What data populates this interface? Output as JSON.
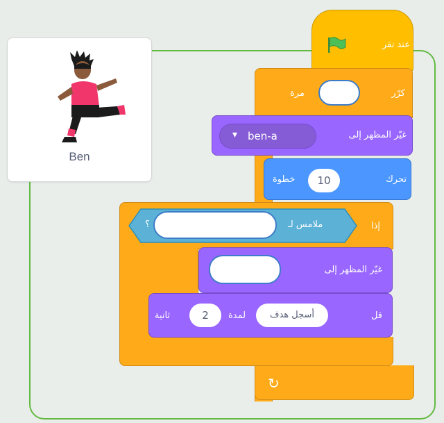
{
  "sprite": {
    "name": "Ben"
  },
  "blocks": {
    "hat": {
      "label": "عند نقر",
      "flag_icon": "green-flag-icon"
    },
    "repeat": {
      "label_times": "مرة",
      "label_repeat": "كرّر",
      "count_value": ""
    },
    "switch_costume_1": {
      "label": "غيّر المظهر إلى",
      "costume": "ben-a",
      "caret": "▾"
    },
    "move": {
      "label_move": "تحرك",
      "steps": "10",
      "label_steps": "خطوة"
    },
    "if_block": {
      "label_if": "إذا",
      "touching_label": "ملامس لـ",
      "touching_value": "",
      "question": "؟"
    },
    "switch_costume_2": {
      "label": "غيّر المظهر إلى",
      "costume_value": ""
    },
    "say": {
      "label_say": "قل",
      "message": "أسجل هدف",
      "label_for": "لمدة",
      "seconds": "2",
      "label_seconds": "ثانية"
    },
    "loop_arrow": "↻"
  },
  "colors": {
    "control": "#ffab19",
    "looks": "#9966ff",
    "motion": "#4c97ff",
    "sensing": "#5cb1d6",
    "events": "#ffbf00",
    "frame": "#63ba42",
    "flag": "#4cbf56"
  }
}
